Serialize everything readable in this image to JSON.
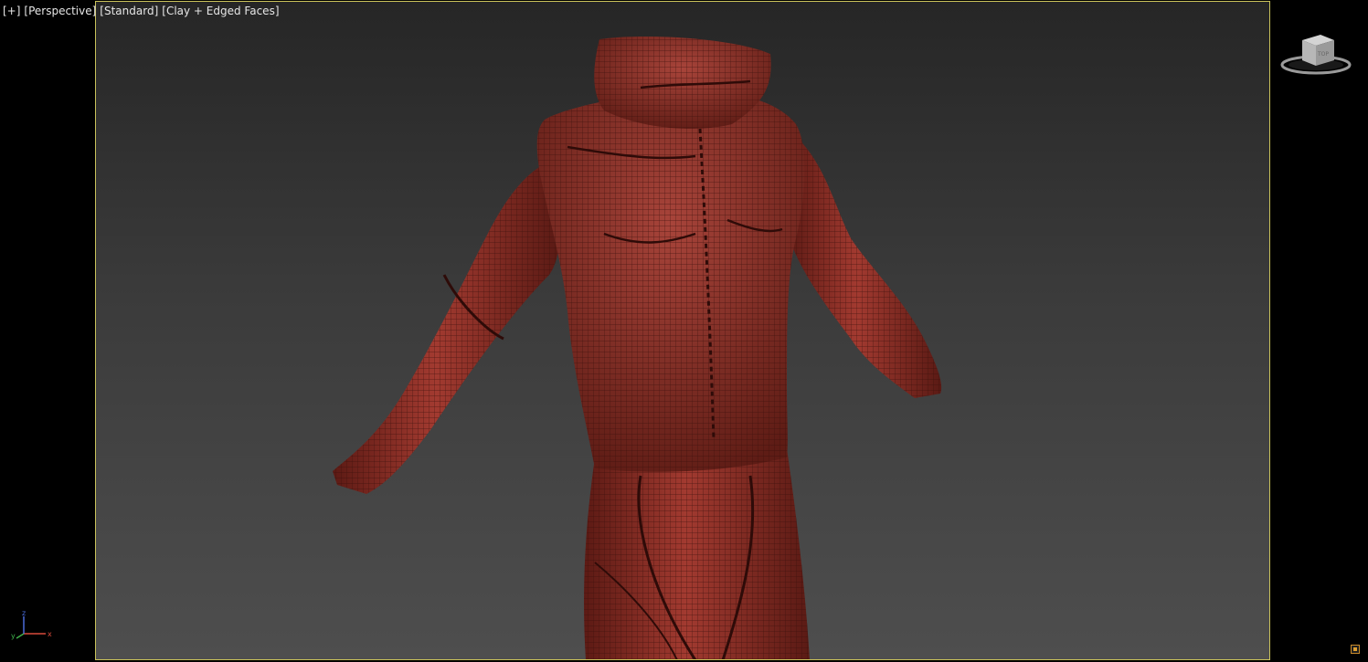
{
  "viewport": {
    "labels": {
      "plus": "[+]",
      "view": "[Perspective]",
      "shading_preset": "[Standard]",
      "shading_mode": "[Clay + Edged Faces]"
    },
    "frame_color": "#c9c25a",
    "background_top": "#262626",
    "background_bottom": "#4e4e4e"
  },
  "model": {
    "surface_color": "#8a2e26",
    "wire_color": "#3a0f0c"
  },
  "viewcube": {
    "face_label": "TOP"
  },
  "axis_tripod": {
    "x_label": "x",
    "y_label": "y",
    "z_label": "z",
    "x_color": "#d84a3a",
    "y_color": "#3fb04a",
    "z_color": "#4a6ad8"
  }
}
